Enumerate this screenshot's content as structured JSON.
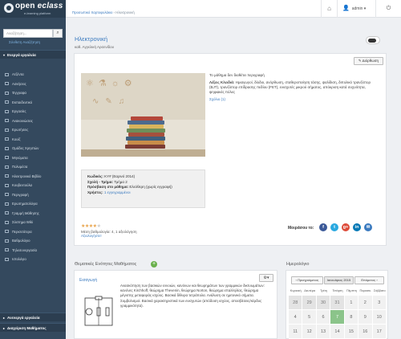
{
  "brand": {
    "name_prefix": "open ",
    "name_suffix": "eclass",
    "tagline": "e-learning platform"
  },
  "topbar": {
    "home_icon": "home-icon",
    "user_label": "admin",
    "exit_icon": "exit-icon"
  },
  "sidebar": {
    "search_placeholder": "Αναζήτηση...",
    "search_icon": "search-icon",
    "advanced_search": "Σύνθετη Αναζήτηση",
    "active_section": "Ενεργά εργαλεία",
    "items": [
      "Ατζέντα",
      "Ασκήσεις",
      "Έγγραφα",
      "Εκπαιδευτικό",
      "Εργασίες",
      "Ανακοινώσεις",
      "Ερωτήσεις",
      "Κουίζ",
      "Ομάδες Χρηστών",
      "Μηνύματα",
      "Πολυμέσα",
      "Ηλεκτρονικό Βιβλίο",
      "Κουβεντούλα",
      "Περιγραφή",
      "Ερωτηματολόγια",
      "Γραμμή Μάθησης",
      "Σύστημα Wiki",
      "Περισσότερα",
      "Βαθμολόγιο",
      "Τηλεσυνεργασία",
      "Ιστολόγιο"
    ],
    "inactive_section": "Ανενεργά εργαλεία",
    "admin_section": "Διαχείριση Μαθήματος"
  },
  "breadcrumb": {
    "root": "Προσωπικό Χαρτοφυλάκιο",
    "current": "Ηλεκτρονική"
  },
  "course": {
    "title": "Ηλεκτρονική",
    "instructor": "καθ. Αγγελική Αρσενίδου",
    "edit_label": "Διόρθωση",
    "description_intro": "Το μάθημα δεν διαθέτει περιγραφή",
    "keywords_label": "Λέξεις Κλειδιά:",
    "keywords": "Ημιαγωγοί, δίοδοι, ανόρθωση, σταθεροποίηση τάσης, ψαλίδιση, διπολικό τρανζίστορ (BJT), τρανζίστορ επίδρασης πεδίου (FET), ενισχυτές μικρού σήματος, απόκριση κατά συχνότητα, ψηφιακές πύλες",
    "more_link": "Σχόλιο (1)",
    "meta": {
      "code_label": "Κωδικός:",
      "code_value": "ΚΥ# (Εαρινό 2014)",
      "school_label": "Σχολή - Τμήμα:",
      "school_value": "Τμήμα 2",
      "access_label": "Πρόσβαση στο μάθημα:",
      "access_value": "Ελεύθερη (χωρίς εγγραφή)",
      "users_label": "Χρήστες:",
      "users_value": "1 εγγεγραμμένοι"
    },
    "rating": {
      "stars_filled": 4,
      "stars_total": 5,
      "text": "Μέση βαθμολογία: 4, 1 αξιολόγηση",
      "link": "Αξιολογήστε!"
    },
    "share": {
      "label": "Μοιράσου το:",
      "networks": [
        {
          "icon": "facebook-icon",
          "glyph": "f",
          "color": "#3b5998"
        },
        {
          "icon": "twitter-icon",
          "glyph": "t",
          "color": "#2aa9e0"
        },
        {
          "icon": "google-plus-icon",
          "glyph": "g+",
          "color": "#dd4b39"
        },
        {
          "icon": "linkedin-icon",
          "glyph": "in",
          "color": "#0077b5"
        },
        {
          "icon": "email-icon",
          "glyph": "✉",
          "color": "#3a7abf"
        }
      ]
    }
  },
  "units": {
    "title": "Θεματικές Ενότητες Μαθήματος",
    "add_icon": "add-icon",
    "gear_icon": "gear-icon",
    "unit_title": "Εισαγωγή",
    "unit_text": "Ανασκόπηση των βασικών εννοιών, κανόνων και θεωρημάτων των γραμμικών δικτυωμάτων: κανόνες Kirchhoff, θεώρημα Thevenin, θεώρημα Norton, θεώρημα επαλληλίας, θεώρημα μέγιστης μεταφοράς ισχύος. Βασικά δίθυρα τετράπολα. Ανάλυση σε ημιτονικό σήματα. Συμβολισμοί. Βασικά χαρακτηριστικά των ενισχυτών (απόδοση ισχύος, αποσβέσεις/κέρδος γραμμικότητα)."
  },
  "calendar": {
    "title": "Ημερολόγιο",
    "prev_label": "‹ Προηγούμενος",
    "current_label": "Ιανουάριος 2015",
    "next_label": "Επόμενος ›",
    "weekdays": [
      "Κυριακή",
      "Δευτέρα",
      "Τρίτη",
      "Τετάρτη",
      "Πέμπτη",
      "Παρασκ.",
      "Σάββατο"
    ],
    "weeks": [
      [
        {
          "d": "28",
          "t": "out"
        },
        {
          "d": "29",
          "t": "out"
        },
        {
          "d": "30",
          "t": "out"
        },
        {
          "d": "31",
          "t": "out"
        },
        {
          "d": "1",
          "t": ""
        },
        {
          "d": "2",
          "t": ""
        },
        {
          "d": "3",
          "t": ""
        }
      ],
      [
        {
          "d": "4",
          "t": ""
        },
        {
          "d": "5",
          "t": ""
        },
        {
          "d": "6",
          "t": ""
        },
        {
          "d": "7",
          "t": "today"
        },
        {
          "d": "8",
          "t": ""
        },
        {
          "d": "9",
          "t": ""
        },
        {
          "d": "10",
          "t": ""
        }
      ],
      [
        {
          "d": "11",
          "t": ""
        },
        {
          "d": "12",
          "t": ""
        },
        {
          "d": "13",
          "t": ""
        },
        {
          "d": "14",
          "t": ""
        },
        {
          "d": "15",
          "t": ""
        },
        {
          "d": "16",
          "t": ""
        },
        {
          "d": "17",
          "t": ""
        }
      ]
    ]
  }
}
